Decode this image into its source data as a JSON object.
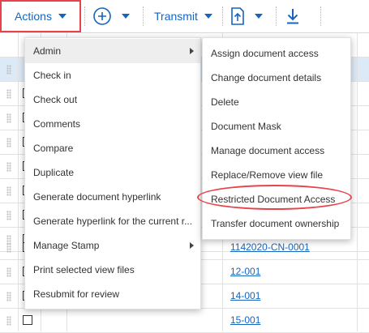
{
  "toolbar": {
    "actions_label": "Actions",
    "transmit_label": "Transmit"
  },
  "actions_menu": {
    "items": [
      {
        "label": "Admin"
      },
      {
        "label": "Check in"
      },
      {
        "label": "Check out"
      },
      {
        "label": "Comments"
      },
      {
        "label": "Compare"
      },
      {
        "label": "Duplicate"
      },
      {
        "label": "Generate document hyperlink"
      },
      {
        "label": "Generate hyperlink for the current r..."
      },
      {
        "label": "Manage Stamp"
      },
      {
        "label": "Print selected view files"
      },
      {
        "label": "Resubmit for review"
      }
    ]
  },
  "admin_submenu": {
    "items": [
      {
        "label": "Assign document access"
      },
      {
        "label": "Change document details"
      },
      {
        "label": "Delete"
      },
      {
        "label": "Document Mask"
      },
      {
        "label": "Manage document access"
      },
      {
        "label": "Replace/Remove view file"
      },
      {
        "label": "Restricted Document Access"
      },
      {
        "label": "Transfer document ownership"
      }
    ]
  },
  "grid": {
    "links": [
      "1142020-CN-0001",
      "12-001",
      "14-001",
      "15-001"
    ]
  },
  "colors": {
    "accent": "#1565c0",
    "highlight": "#e8434a",
    "selected_row": "#dce9f7"
  }
}
